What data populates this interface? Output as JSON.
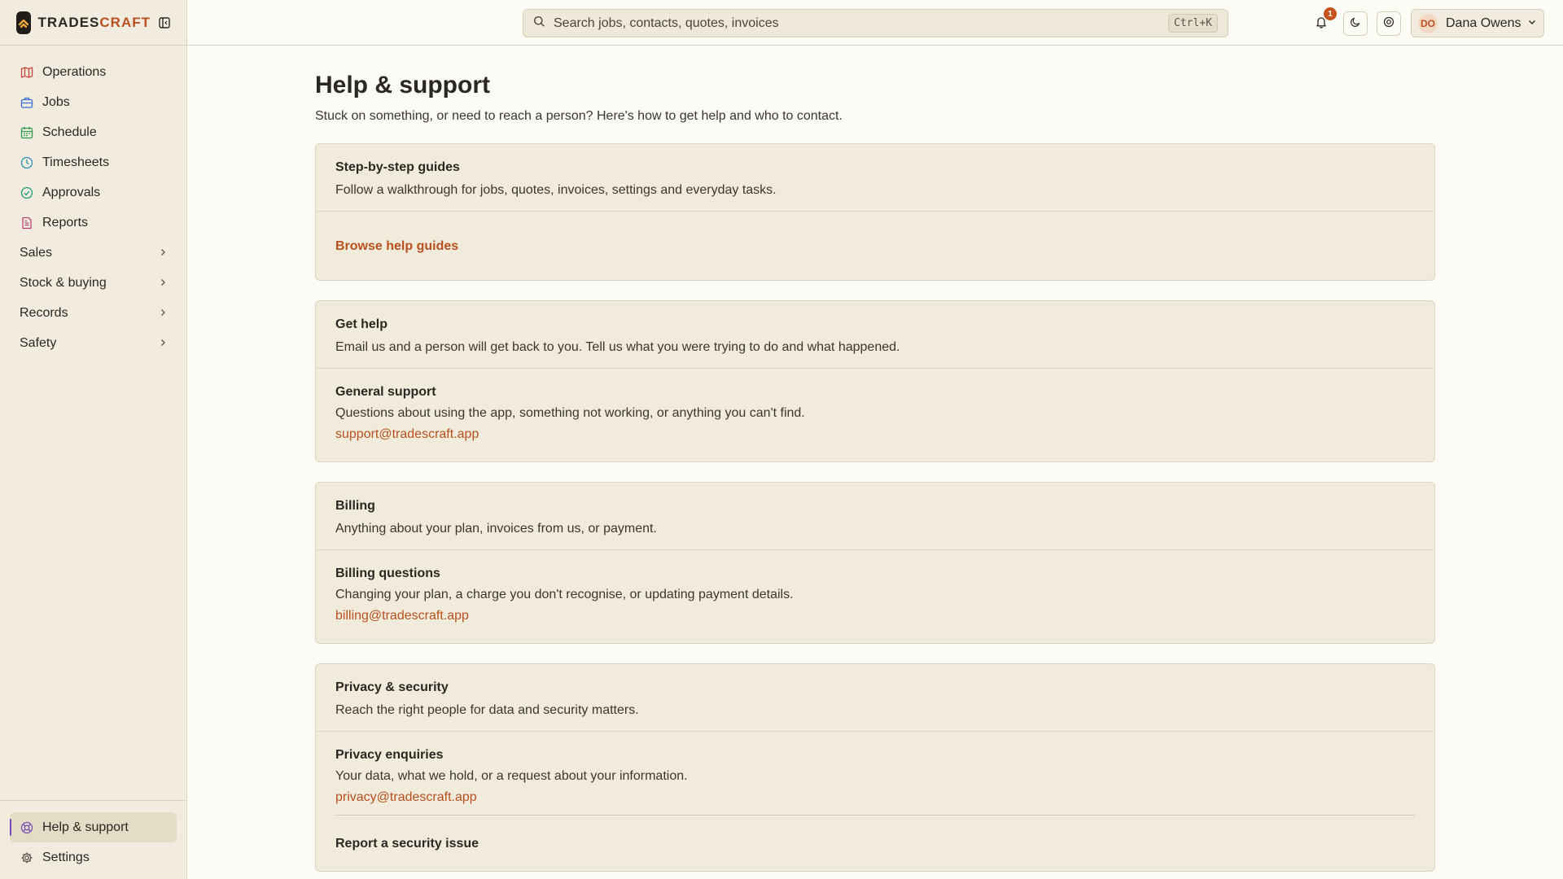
{
  "brand": {
    "name_part1": "TRADES",
    "name_part2": "CRAFT"
  },
  "sidebar": {
    "items": [
      {
        "label": "Operations",
        "icon": "map-icon",
        "color": "#c9413a"
      },
      {
        "label": "Jobs",
        "icon": "briefcase-icon",
        "color": "#3a6fd8"
      },
      {
        "label": "Schedule",
        "icon": "calendar-icon",
        "color": "#2f9b4e"
      },
      {
        "label": "Timesheets",
        "icon": "clock-icon",
        "color": "#2a8fb8"
      },
      {
        "label": "Approvals",
        "icon": "check-circle-icon",
        "color": "#1f9c7d"
      },
      {
        "label": "Reports",
        "icon": "report-icon",
        "color": "#b8457a"
      }
    ],
    "groups": [
      {
        "label": "Sales"
      },
      {
        "label": "Stock & buying"
      },
      {
        "label": "Records"
      },
      {
        "label": "Safety"
      }
    ],
    "bottom": [
      {
        "label": "Help & support",
        "icon": "lifebuoy-icon",
        "active": true
      },
      {
        "label": "Settings",
        "icon": "gear-icon"
      }
    ]
  },
  "topbar": {
    "search_placeholder": "Search jobs, contacts, quotes, invoices",
    "search_shortcut": "Ctrl+K",
    "notification_count": "1",
    "user_initials": "DO",
    "user_name": "Dana Owens"
  },
  "page": {
    "title": "Help & support",
    "subtitle": "Stuck on something, or need to reach a person? Here's how to get help and who to contact."
  },
  "cards": {
    "guides": {
      "title": "Step-by-step guides",
      "desc": "Follow a walkthrough for jobs, quotes, invoices, settings and everyday tasks.",
      "link": "Browse help guides"
    },
    "help": {
      "title": "Get help",
      "desc": "Email us and a person will get back to you. Tell us what you were trying to do and what happened.",
      "entry_title": "General support",
      "entry_desc": "Questions about using the app, something not working, or anything you can't find.",
      "entry_link": "support@tradescraft.app"
    },
    "billing": {
      "title": "Billing",
      "desc": "Anything about your plan, invoices from us, or payment.",
      "entry_title": "Billing questions",
      "entry_desc": "Changing your plan, a charge you don't recognise, or updating payment details.",
      "entry_link": "billing@tradescraft.app"
    },
    "privacy": {
      "title": "Privacy & security",
      "desc": "Reach the right people for data and security matters.",
      "entry1_title": "Privacy enquiries",
      "entry1_desc": "Your data, what we hold, or a request about your information.",
      "entry1_link": "privacy@tradescraft.app",
      "entry2_title": "Report a security issue"
    }
  },
  "colors": {
    "accent": "#b8501f",
    "sidebar_bg": "#f1ecdf",
    "card_bg": "#f1ebdb"
  }
}
